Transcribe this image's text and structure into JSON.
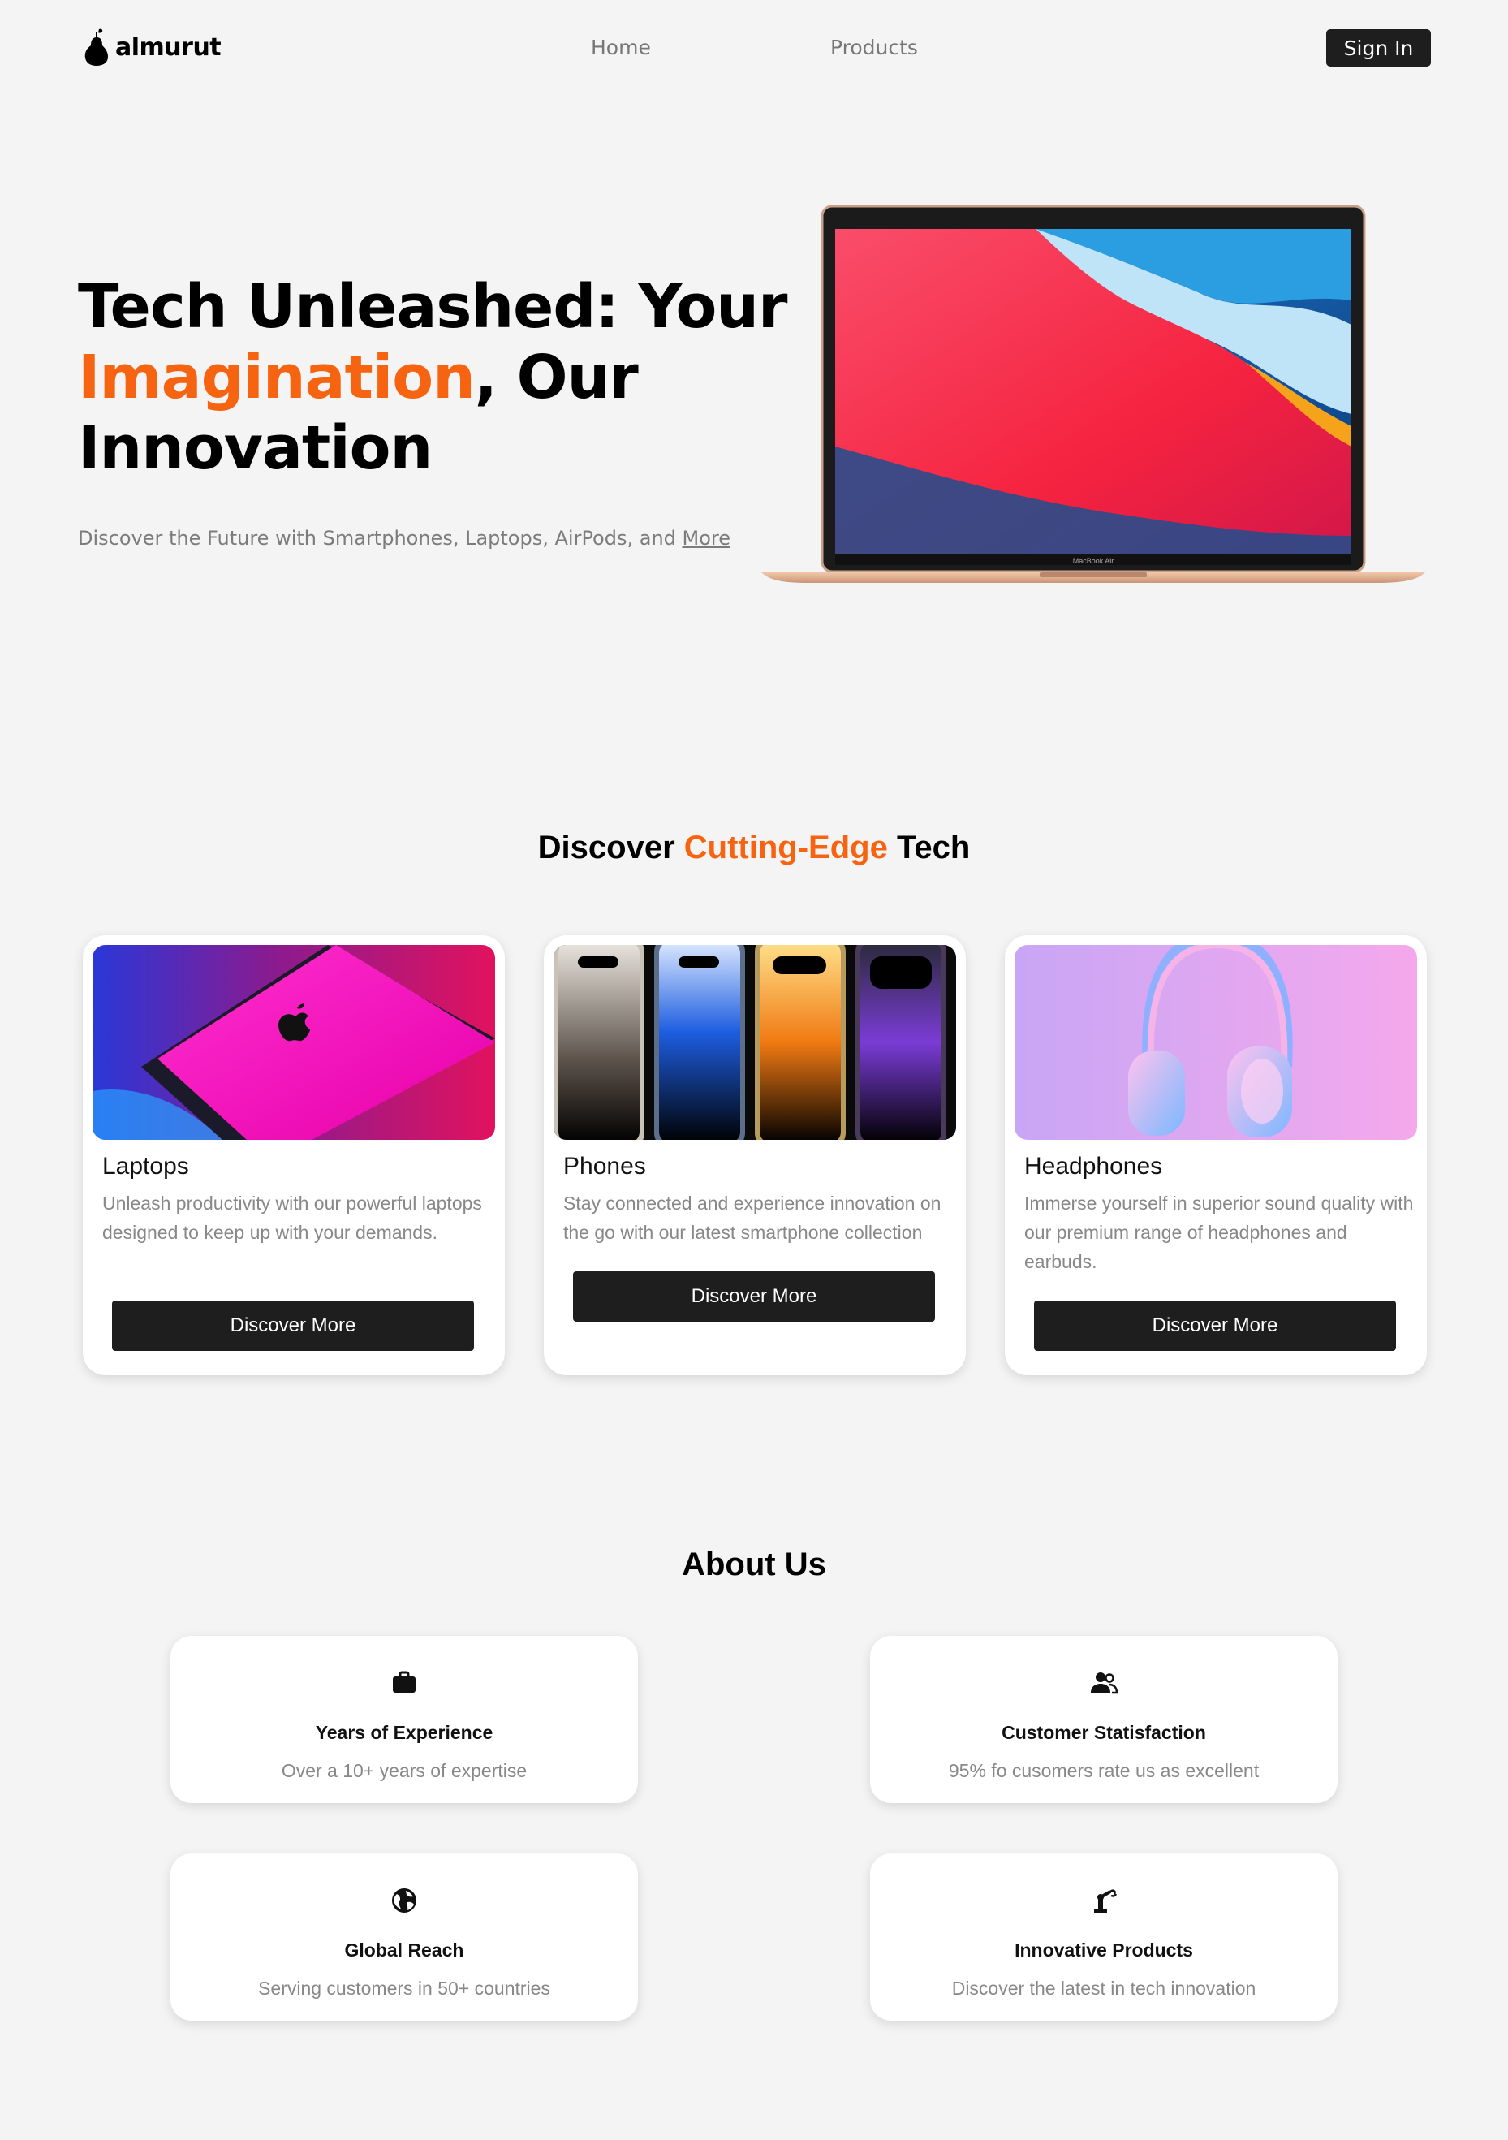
{
  "nav": {
    "brand": "almurut",
    "links": [
      "Home",
      "Products"
    ],
    "signin_label": "Sign In"
  },
  "hero": {
    "title_part1": "Tech Unleashed: Your",
    "title_accent": "Imagination",
    "title_part2": ", Our",
    "title_part3": "Innovation",
    "subtitle": "Discover the Future with Smartphones, Laptops, AirPods, and ",
    "subtitle_link": "More",
    "laptop_caption": "MacBook Air"
  },
  "discover": {
    "title_part1": "Discover ",
    "title_accent": "Cutting-Edge",
    "title_part2": " Tech",
    "cards": [
      {
        "title": "Laptops",
        "desc": "Unleash productivity with our powerful laptops designed to keep up with your demands.",
        "button": "Discover More"
      },
      {
        "title": "Phones",
        "desc": "Stay connected and experience innovation on the go with our latest smartphone collection",
        "button": "Discover More"
      },
      {
        "title": "Headphones",
        "desc": "Immerse yourself in superior sound quality with our premium range of headphones and earbuds.",
        "button": "Discover More"
      }
    ]
  },
  "about": {
    "title": "About Us",
    "items": [
      {
        "icon": "briefcase-icon",
        "head": "Years of Experience",
        "text": "Over a 10+ years of expertise"
      },
      {
        "icon": "users-icon",
        "head": "Customer Statisfaction",
        "text": "95% fo cusomers rate us as excellent"
      },
      {
        "icon": "globe-icon",
        "head": "Global Reach",
        "text": "Serving customers in 50+ countries"
      },
      {
        "icon": "robot-arm-icon",
        "head": "Innovative Products",
        "text": "Discover the latest in tech innovation"
      }
    ]
  },
  "colors": {
    "accent": "#f76411",
    "dark": "#1e1e1e",
    "background": "#f4f4f4"
  }
}
